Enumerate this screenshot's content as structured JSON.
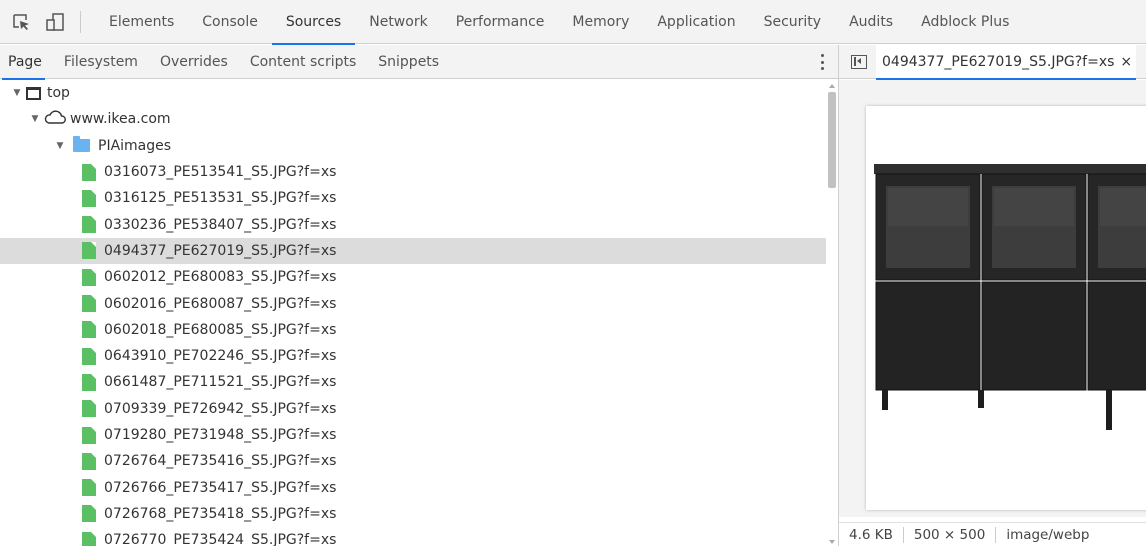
{
  "main_tabs": [
    {
      "label": "Elements",
      "active": false
    },
    {
      "label": "Console",
      "active": false
    },
    {
      "label": "Sources",
      "active": true
    },
    {
      "label": "Network",
      "active": false
    },
    {
      "label": "Performance",
      "active": false
    },
    {
      "label": "Memory",
      "active": false
    },
    {
      "label": "Application",
      "active": false
    },
    {
      "label": "Security",
      "active": false
    },
    {
      "label": "Audits",
      "active": false
    },
    {
      "label": "Adblock Plus",
      "active": false
    }
  ],
  "navigator_tabs": [
    {
      "label": "Page",
      "active": true
    },
    {
      "label": "Filesystem",
      "active": false
    },
    {
      "label": "Overrides",
      "active": false
    },
    {
      "label": "Content scripts",
      "active": false
    },
    {
      "label": "Snippets",
      "active": false
    }
  ],
  "tree": {
    "top": "top",
    "domain": "www.ikea.com",
    "folder": "PIAimages",
    "files": [
      "0316073_PE513541_S5.JPG?f=xs",
      "0316125_PE513531_S5.JPG?f=xs",
      "0330236_PE538407_S5.JPG?f=xs",
      "0494377_PE627019_S5.JPG?f=xs",
      "0602012_PE680083_S5.JPG?f=xs",
      "0602016_PE680087_S5.JPG?f=xs",
      "0602018_PE680085_S5.JPG?f=xs",
      "0643910_PE702246_S5.JPG?f=xs",
      "0661487_PE711521_S5.JPG?f=xs",
      "0709339_PE726942_S5.JPG?f=xs",
      "0719280_PE731948_S5.JPG?f=xs",
      "0726764_PE735416_S5.JPG?f=xs",
      "0726766_PE735417_S5.JPG?f=xs",
      "0726768_PE735418_S5.JPG?f=xs",
      "0726770_PE735424_S5.JPG?f=xs"
    ],
    "selected_index": 3
  },
  "editor": {
    "tab_title": "0494377_PE627019_S5.JPG?f=xs",
    "close_glyph": "×"
  },
  "status": {
    "size": "4.6 KB",
    "dimensions": "500 × 500",
    "mime": "image/webp"
  },
  "colors": {
    "accent": "#1a73e8",
    "file_icon": "#5bbf63",
    "folder_icon": "#69b3f1",
    "selected_row": "#dcdcdc",
    "furniture": "#2a2a2a"
  },
  "icons": {
    "inspect": "inspect-element-icon",
    "device": "device-toolbar-icon",
    "more": "kebab-menu-icon",
    "toggle_navigator": "toggle-navigator-icon"
  }
}
